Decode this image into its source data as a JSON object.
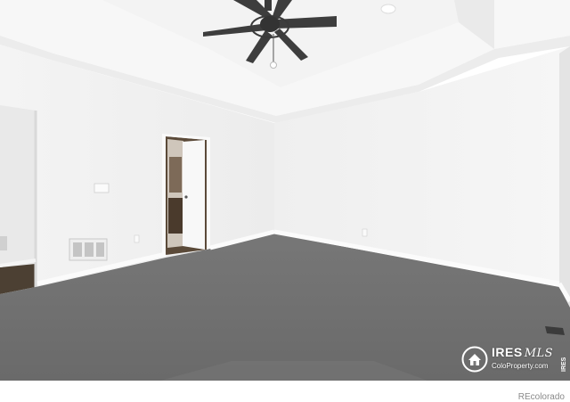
{
  "photo": {
    "subject": "empty carpeted bedroom with tray ceiling and ceiling fan",
    "colors": {
      "wall": "#f2f2f2",
      "wall_shadow": "#e6e6e6",
      "ceiling": "#f6f6f6",
      "carpet": "#6f6f6f",
      "trim": "#fbfbfb",
      "fan": "#3a3a3a"
    }
  },
  "watermark": {
    "brand": "IRES",
    "brand_script": "MLS",
    "url": "ColoProperty.com",
    "side_text": "IRES",
    "logo_icon": "house-seal-icon"
  },
  "footer": {
    "credit": "REcolorado"
  }
}
